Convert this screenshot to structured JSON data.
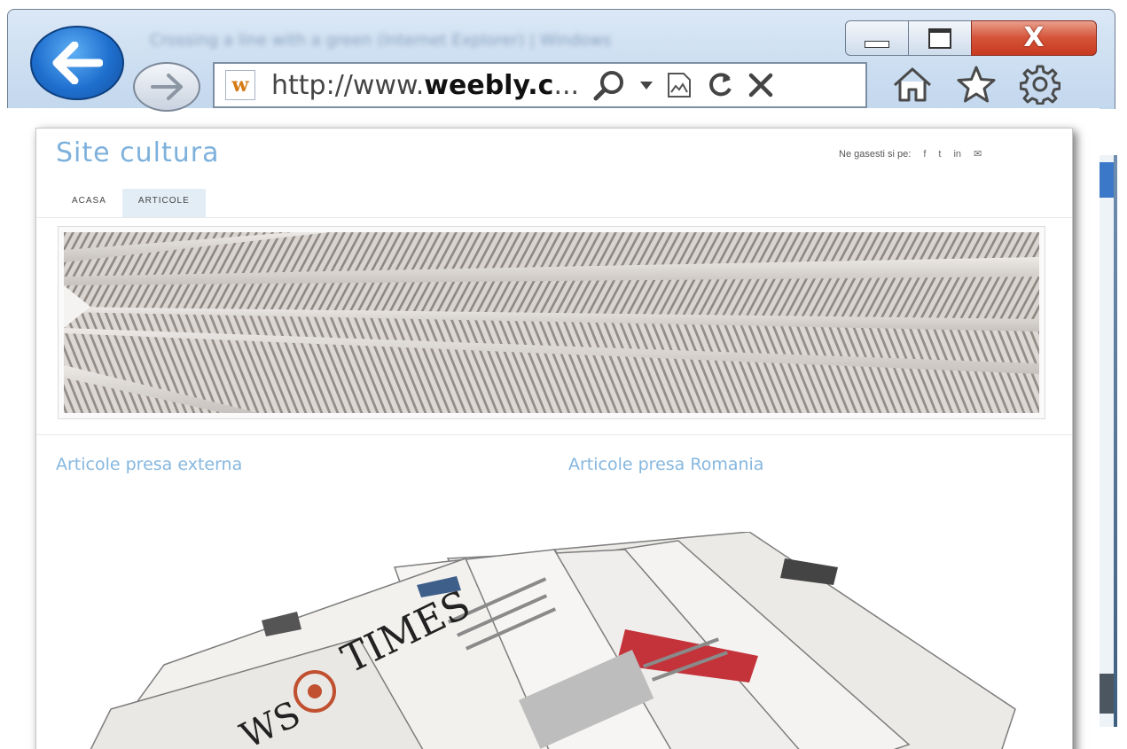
{
  "browser": {
    "window_title": "Crossing a line with a green (Internet Explorer) | Windows",
    "url_prefix": "http://www.",
    "url_domain": "weebly.c",
    "url_suffix": "...",
    "favicon_letter": "w",
    "close_glyph": "X"
  },
  "site": {
    "title": "Site cultura",
    "social_label": "Ne gasesti si pe:",
    "social_icons": [
      "f",
      "t",
      "in",
      "✉"
    ],
    "nav": [
      {
        "label": "ACASA",
        "active": false
      },
      {
        "label": "ARTICOLE",
        "active": true
      }
    ],
    "columns": [
      {
        "title": "Articole presa externa"
      },
      {
        "title": "Articole presa Romania"
      }
    ],
    "newspaper_masthead": "TIMES",
    "newspaper_masthead2": "WS"
  }
}
